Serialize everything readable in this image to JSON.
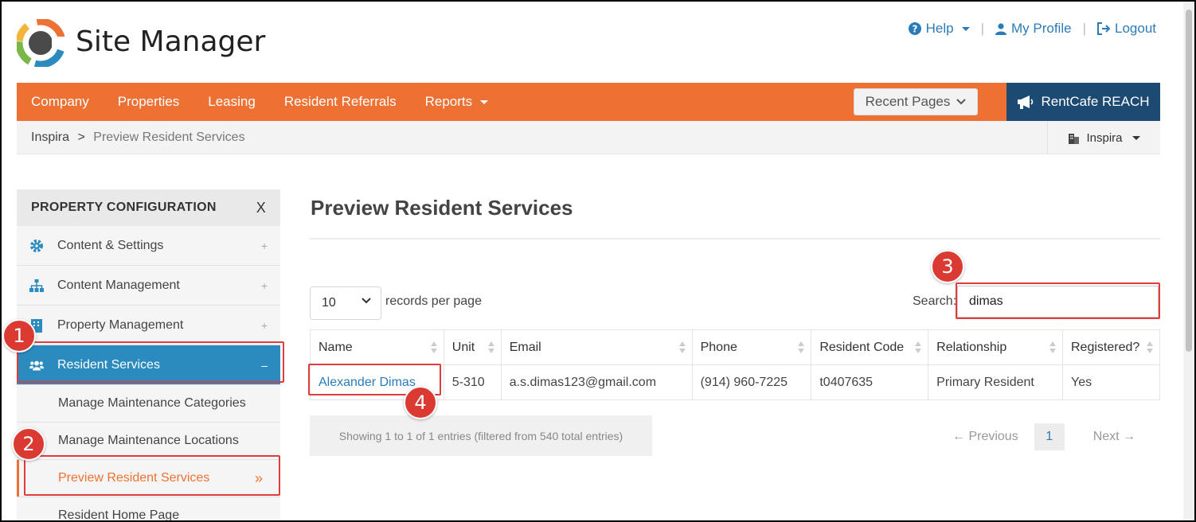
{
  "app": {
    "title": "Site Manager"
  },
  "toplinks": {
    "help": "Help",
    "profile": "My Profile",
    "logout": "Logout"
  },
  "nav": {
    "items": [
      "Company",
      "Properties",
      "Leasing",
      "Resident Referrals",
      "Reports"
    ],
    "recent_pages": "Recent Pages",
    "reach": "RentCafe REACH"
  },
  "breadcrumb": {
    "root": "Inspira",
    "sep": ">",
    "current": "Preview Resident Services"
  },
  "property_switch": "Inspira",
  "sidebar": {
    "title": "PROPERTY CONFIGURATION",
    "close": "X",
    "items": [
      {
        "label": "Content & Settings",
        "icon": "gear-icon",
        "toggle": "+"
      },
      {
        "label": "Content Management",
        "icon": "sitemap-icon",
        "toggle": "+"
      },
      {
        "label": "Property Management",
        "icon": "building-icon",
        "toggle": "+"
      },
      {
        "label": "Resident Services",
        "icon": "users-icon",
        "toggle": "–"
      }
    ],
    "subitems": [
      "Manage Maintenance Categories",
      "Manage Maintenance Locations",
      "Preview Resident Services",
      "Resident Home Page"
    ]
  },
  "main": {
    "title": "Preview Resident Services",
    "length_value": "10",
    "length_label": "records per page",
    "search_label": "Search:",
    "search_value": "dimas",
    "columns": [
      "Name",
      "Unit",
      "Email",
      "Phone",
      "Resident Code",
      "Relationship",
      "Registered?"
    ],
    "rows": [
      {
        "name": "Alexander Dimas",
        "unit": "5-310",
        "email": "a.s.dimas123@gmail.com",
        "phone": "(914) 960-7225",
        "code": "t0407635",
        "relationship": "Primary Resident",
        "registered": "Yes"
      }
    ],
    "info": "Showing 1 to 1 of 1 entries (filtered from 540 total entries)",
    "pager": {
      "prev": "← Previous",
      "page": "1",
      "next": "Next →"
    }
  },
  "annotations": [
    "1",
    "2",
    "3",
    "4"
  ],
  "colors": {
    "nav": "#ee7134",
    "reach": "#1c4a72",
    "active": "#2b8bbf",
    "link": "#2b7bb9",
    "badge": "#db3a33"
  }
}
